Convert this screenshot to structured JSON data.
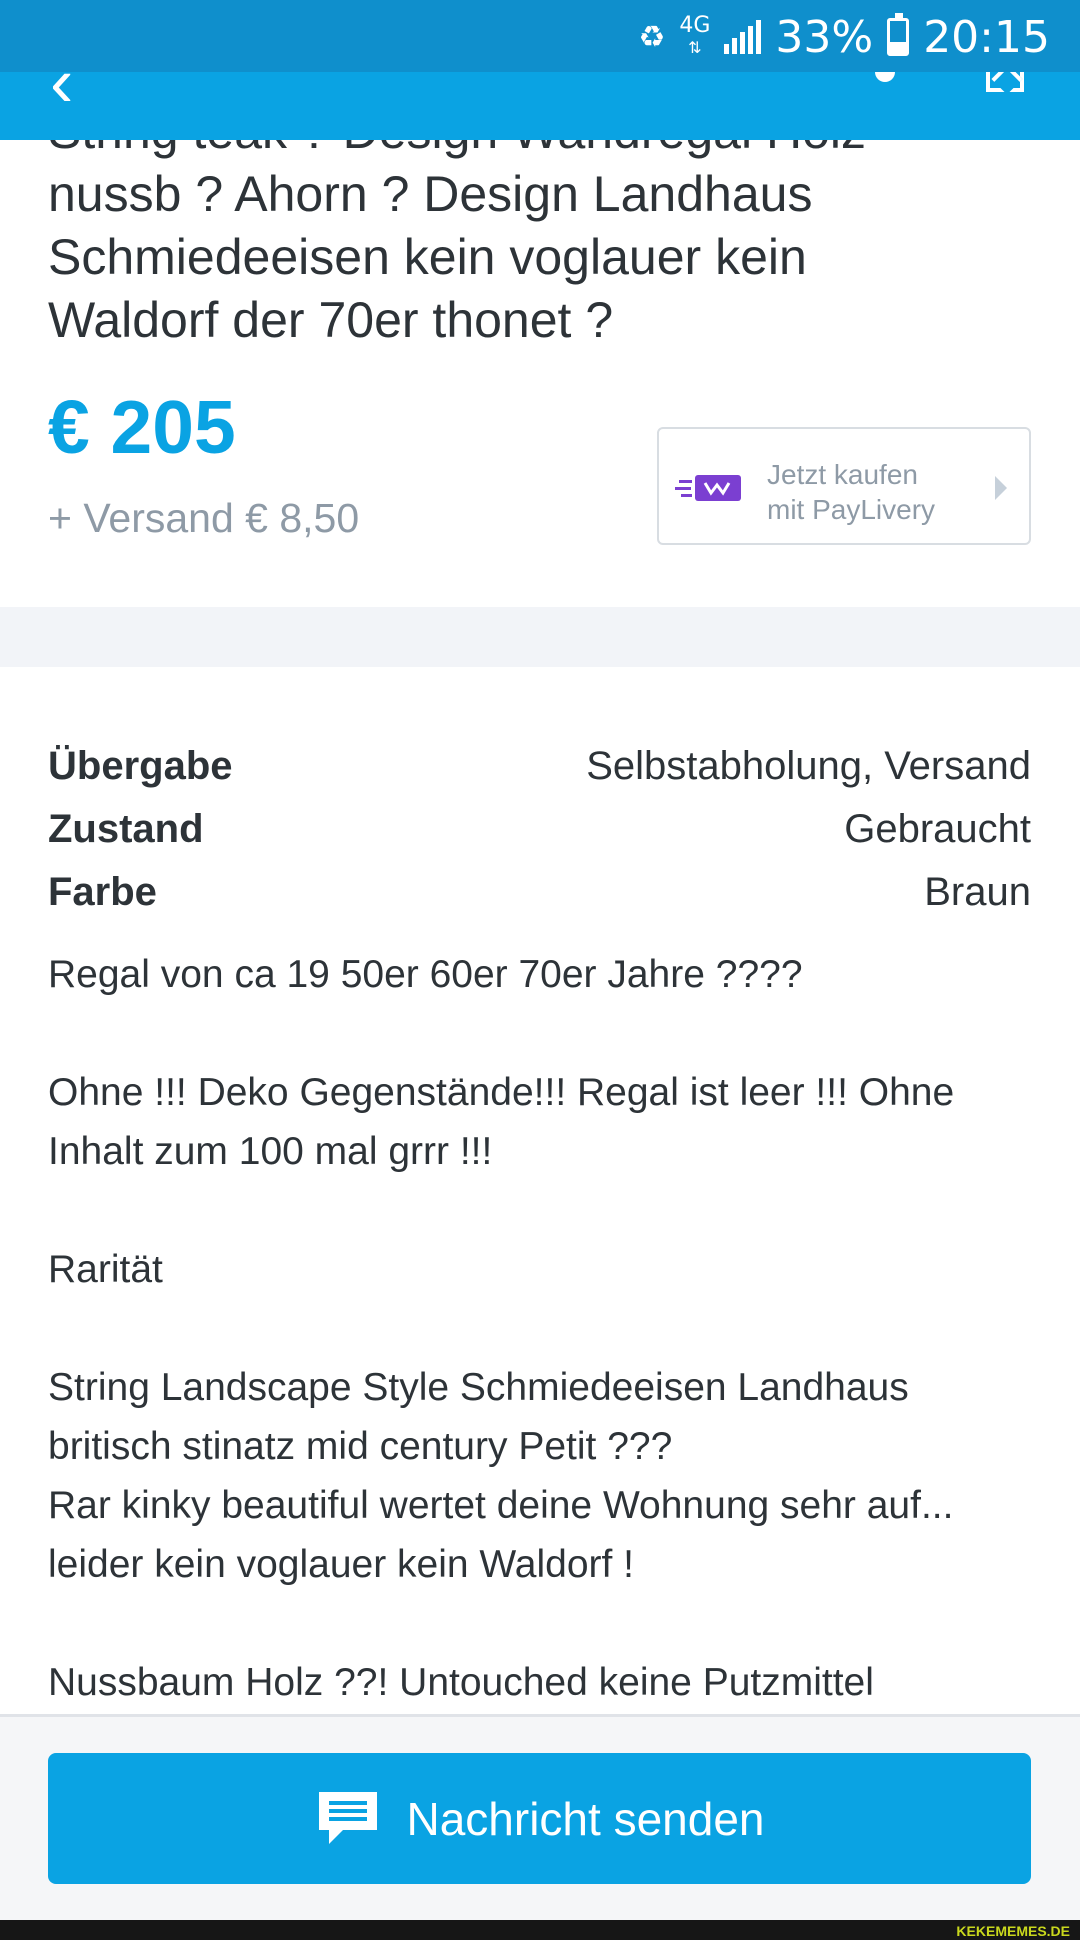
{
  "status_bar": {
    "network": "4G",
    "battery_percent": "33%",
    "time": "20:15",
    "battery_level": 0.33
  },
  "listing": {
    "title_lines": [
      "String teak ? Design Wandregal Holz",
      "nussb ? Ahorn ? Design Landhaus",
      "Schmiedeeisen kein voglauer kein",
      "Waldorf der 70er thonet ?"
    ],
    "price": "€ 205",
    "shipping": "+ Versand € 8,50"
  },
  "paylivery": {
    "line1": "Jetzt kaufen",
    "line2": "mit PayLivery",
    "brand_color": "#7b3fd1"
  },
  "properties": [
    {
      "key": "Übergabe",
      "value": "Selbstabholung, Versand"
    },
    {
      "key": "Zustand",
      "value": "Gebraucht"
    },
    {
      "key": "Farbe",
      "value": "Braun"
    }
  ],
  "description": {
    "p1": "Regal von ca 19 50er 60er 70er Jahre ????",
    "p2a": "Ohne !!! Deko Gegenstände!!! Regal ist leer !!! Ohne",
    "p2b": "Inhalt zum 100 mal grrr !!!",
    "p3": "Rarität",
    "p4a": "String Landscape Style Schmiedeeisen Landhaus",
    "p4b": "britisch stinatz mid century Petit ???",
    "p4c": "Rar kinky beautiful wertet deine Wohnung sehr auf...",
    "p4d": "leider kein voglauer kein Waldorf !",
    "p5": "Nussbaum Holz ??! Untouched keine Putzmittel"
  },
  "actions": {
    "send_message": "Nachricht senden"
  },
  "watermark": "KEKEMEMES.DE",
  "colors": {
    "primary": "#0aa3e3",
    "status_bar": "#0f8fcc",
    "text": "#2d3338",
    "muted": "#8e9aa6"
  }
}
